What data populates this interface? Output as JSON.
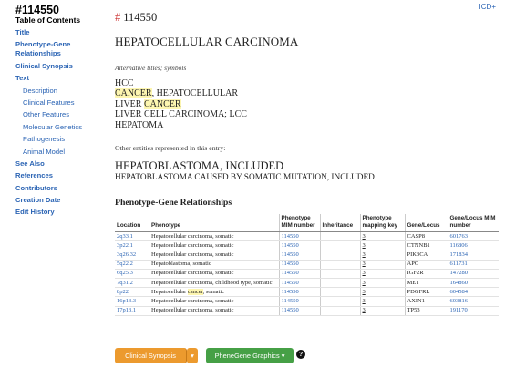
{
  "sidebar": {
    "mim_number": "#114550",
    "toc_title": "Table of Contents",
    "items": [
      {
        "label": "Title",
        "level": "main"
      },
      {
        "label": "Phenotype-Gene Relationships",
        "level": "main"
      },
      {
        "label": "Clinical Synopsis",
        "level": "main"
      },
      {
        "label": "Text",
        "level": "main"
      },
      {
        "label": "Description",
        "level": "sub"
      },
      {
        "label": "Clinical Features",
        "level": "sub"
      },
      {
        "label": "Other Features",
        "level": "sub"
      },
      {
        "label": "Molecular Genetics",
        "level": "sub"
      },
      {
        "label": "Pathogenesis",
        "level": "sub"
      },
      {
        "label": "Animal Model",
        "level": "sub"
      },
      {
        "label": "See Also",
        "level": "main"
      },
      {
        "label": "References",
        "level": "main"
      },
      {
        "label": "Contributors",
        "level": "main"
      },
      {
        "label": "Creation Date",
        "level": "main"
      },
      {
        "label": "Edit History",
        "level": "main"
      }
    ]
  },
  "header": {
    "icd_link": "ICD+"
  },
  "entry": {
    "hash_symbol": "#",
    "number": "114550",
    "title": "HEPATOCELLULAR CARCINOMA",
    "alt_titles_label": "Alternative titles; symbols",
    "alt_titles": [
      [
        {
          "text": "HCC",
          "hl": false
        }
      ],
      [
        {
          "text": "CANCER",
          "hl": true
        },
        {
          "text": ", HEPATOCELLULAR",
          "hl": false
        }
      ],
      [
        {
          "text": "LIVER ",
          "hl": false
        },
        {
          "text": "CANCER",
          "hl": true
        }
      ],
      [
        {
          "text": "LIVER CELL CARCINOMA; LCC",
          "hl": false
        }
      ],
      [
        {
          "text": "HEPATOMA",
          "hl": false
        }
      ]
    ],
    "other_entities_label": "Other entities represented in this entry:",
    "included_title": "HEPATOBLASTOMA, INCLUDED",
    "included_subtitle": "HEPATOBLASTOMA CAUSED BY SOMATIC MUTATION, INCLUDED",
    "pg_heading": "Phenotype-Gene Relationships"
  },
  "table": {
    "headers": [
      "Location",
      "Phenotype",
      "Phenotype MIM number",
      "Inheritance",
      "Phenotype mapping key",
      "Gene/Locus",
      "Gene/Locus MIM number"
    ],
    "rows": [
      {
        "location": "2q33.1",
        "phenotype": [
          {
            "text": "Hepatocellular carcinoma, somatic",
            "hl": false
          }
        ],
        "pheno_mim": "114550",
        "inheritance": "",
        "key": "3",
        "gene": "CASP8",
        "gene_mim": "601763"
      },
      {
        "location": "3p22.1",
        "phenotype": [
          {
            "text": "Hepatocellular carcinoma, somatic",
            "hl": false
          }
        ],
        "pheno_mim": "114550",
        "inheritance": "",
        "key": "3",
        "gene": "CTNNB1",
        "gene_mim": "116806"
      },
      {
        "location": "3q26.32",
        "phenotype": [
          {
            "text": "Hepatocellular carcinoma, somatic",
            "hl": false
          }
        ],
        "pheno_mim": "114550",
        "inheritance": "",
        "key": "3",
        "gene": "PIK3CA",
        "gene_mim": "171834"
      },
      {
        "location": "5q22.2",
        "phenotype": [
          {
            "text": "Hepatoblastoma, somatic",
            "hl": false
          }
        ],
        "pheno_mim": "114550",
        "inheritance": "",
        "key": "3",
        "gene": "APC",
        "gene_mim": "611731"
      },
      {
        "location": "6q25.3",
        "phenotype": [
          {
            "text": "Hepatocellular carcinoma, somatic",
            "hl": false
          }
        ],
        "pheno_mim": "114550",
        "inheritance": "",
        "key": "3",
        "gene": "IGF2R",
        "gene_mim": "147280"
      },
      {
        "location": "7q31.2",
        "phenotype": [
          {
            "text": "Hepatocellular carcinoma, childhood type, somatic",
            "hl": false
          }
        ],
        "pheno_mim": "114550",
        "inheritance": "",
        "key": "3",
        "gene": "MET",
        "gene_mim": "164860"
      },
      {
        "location": "8p22",
        "phenotype": [
          {
            "text": "Hepatocellular ",
            "hl": false
          },
          {
            "text": "cancer",
            "hl": true
          },
          {
            "text": ", somatic",
            "hl": false
          }
        ],
        "pheno_mim": "114550",
        "inheritance": "",
        "key": "3",
        "gene": "PDGFRL",
        "gene_mim": "604584"
      },
      {
        "location": "16p13.3",
        "phenotype": [
          {
            "text": "Hepatocellular carcinoma, somatic",
            "hl": false
          }
        ],
        "pheno_mim": "114550",
        "inheritance": "",
        "key": "3",
        "gene": "AXIN1",
        "gene_mim": "603816"
      },
      {
        "location": "17p13.1",
        "phenotype": [
          {
            "text": "Hepatocellular carcinoma, somatic",
            "hl": false
          }
        ],
        "pheno_mim": "114550",
        "inheritance": "",
        "key": "3",
        "gene": "TP53",
        "gene_mim": "191170"
      }
    ]
  },
  "buttons": {
    "clinical_synopsis": "Clinical Synopsis",
    "caret": "▾",
    "phenegene": "PheneGene Graphics ▾",
    "help": "?"
  },
  "colors": {
    "link": "#2b64b4",
    "orange": "#ec9a2e",
    "green": "#46a046",
    "highlight": "#fdf6b0",
    "hash": "#cc3333"
  }
}
